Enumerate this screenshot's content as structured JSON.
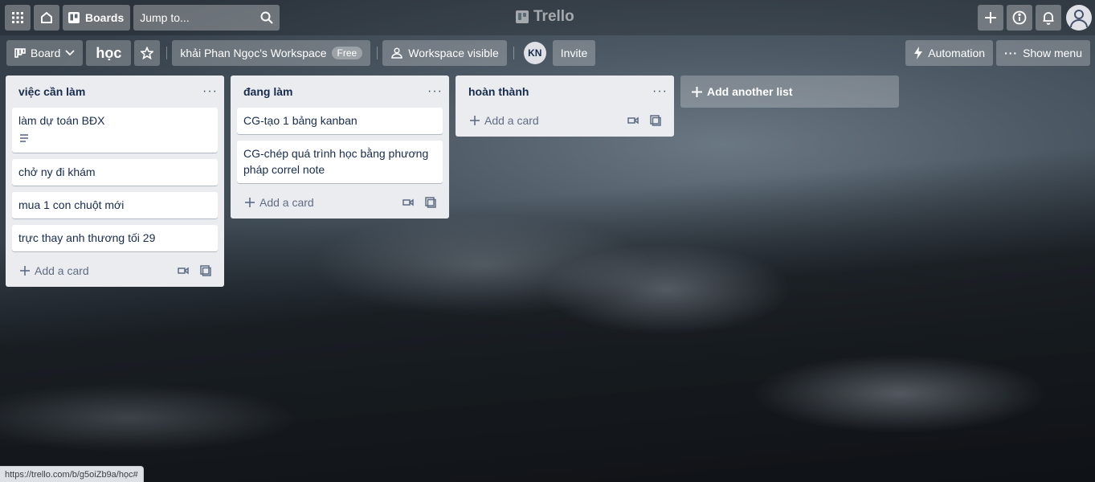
{
  "topbar": {
    "boards_label": "Boards",
    "search_placeholder": "Jump to...",
    "logo_text": "Trello"
  },
  "boardbar": {
    "view_label": "Board",
    "board_title": "học",
    "workspace_label": "khải Phan Ngọc's Workspace",
    "workspace_badge": "Free",
    "visibility_label": "Workspace visible",
    "member_initials": "KN",
    "invite_label": "Invite",
    "automation_label": "Automation",
    "show_menu_label": "Show menu"
  },
  "lists": [
    {
      "title": "việc cần làm",
      "cards": [
        "làm dự toán BĐX",
        "chở ny đi khám",
        "mua 1 con chuột mới",
        "trực thay anh thương tối 29"
      ],
      "add_card_label": "Add a card"
    },
    {
      "title": "đang làm",
      "cards": [
        "CG-tạo 1 bảng kanban",
        "CG-chép quá trình học bằng phương pháp correl note"
      ],
      "add_card_label": "Add a card"
    },
    {
      "title": "hoàn thành",
      "cards": [],
      "add_card_label": "Add a card"
    }
  ],
  "add_list_label": "Add another list",
  "status_url": "https://trello.com/b/g5oiZb9a/học#",
  "colors": {
    "list_bg": "#ebecf0",
    "card_bg": "#ffffff",
    "text": "#172b4d",
    "muted": "#5e6c84"
  }
}
